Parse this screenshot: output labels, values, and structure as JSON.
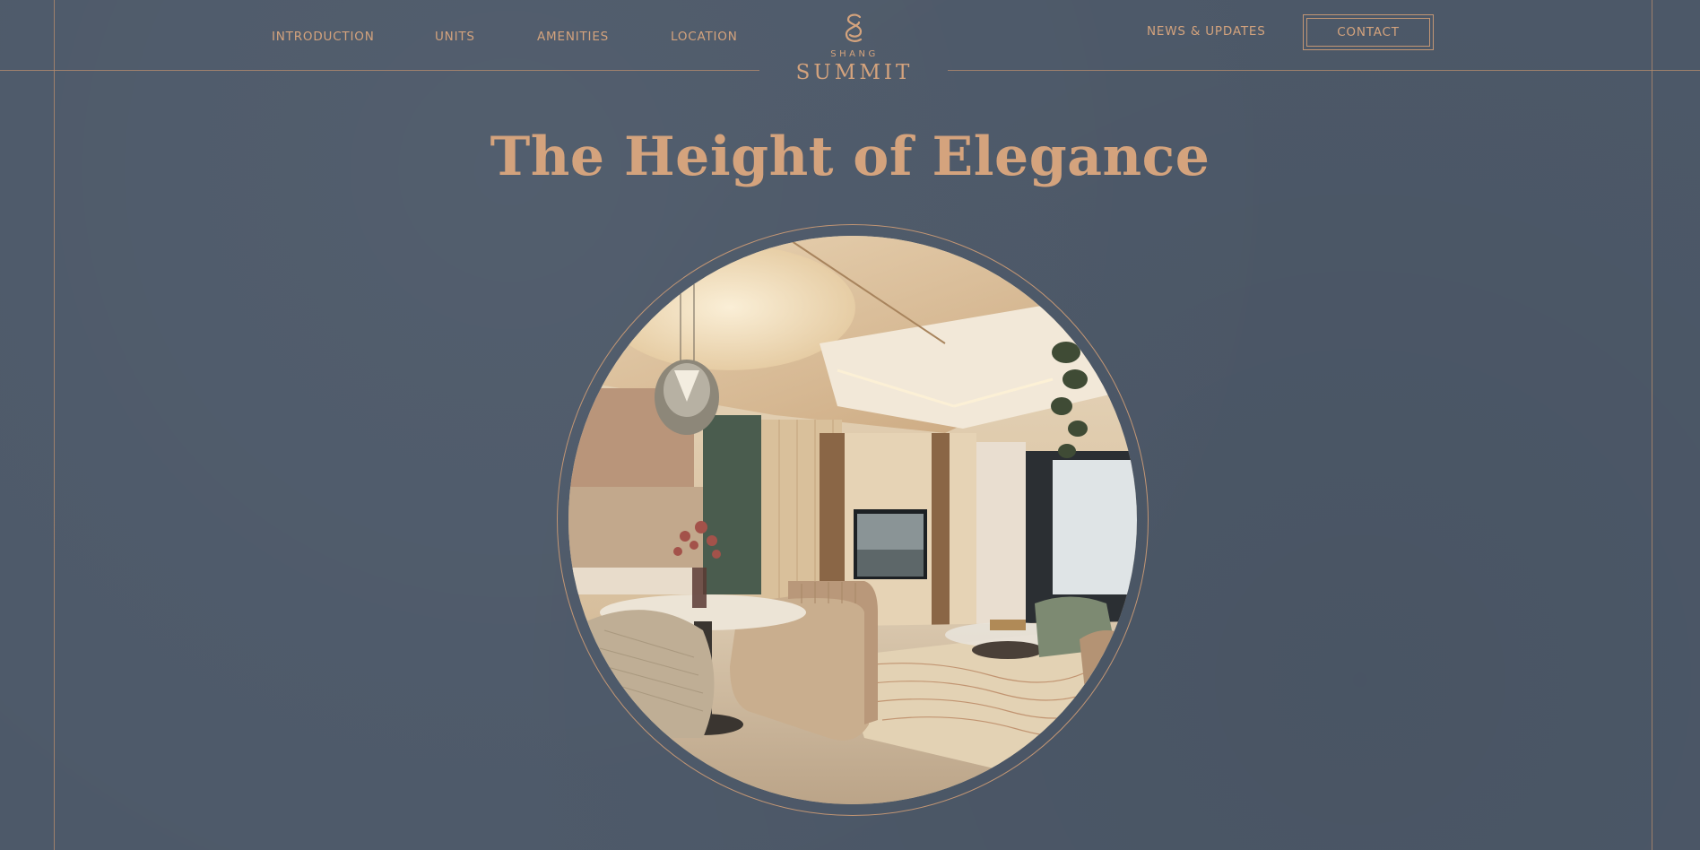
{
  "nav": {
    "left_items": [
      {
        "label": "INTRODUCTION"
      },
      {
        "label": "UNITS"
      },
      {
        "label": "AMENITIES"
      },
      {
        "label": "LOCATION"
      }
    ],
    "news_label": "NEWS & UPDATES",
    "contact_label": "CONTACT"
  },
  "logo": {
    "small": "SHANG",
    "large": "SUMMIT"
  },
  "hero": {
    "headline": "The Height of Elegance"
  },
  "colors": {
    "background": "#4d5969",
    "accent": "#d4a37d",
    "line": "#b98e6d"
  }
}
